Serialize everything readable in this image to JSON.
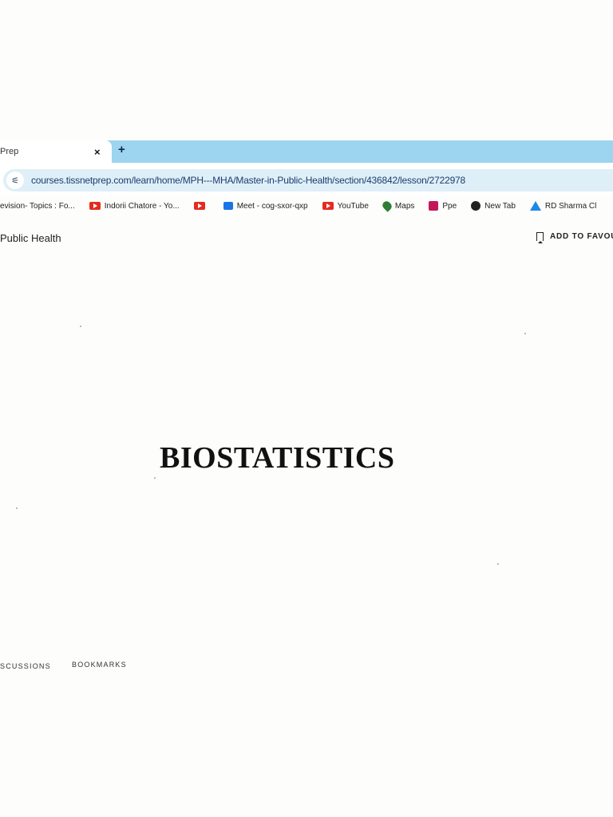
{
  "browser": {
    "active_tab_title": "Prep",
    "tab_close_glyph": "×",
    "new_tab_glyph": "+",
    "url": "courses.tissnetprep.com/learn/home/MPH---MHA/Master-in-Public-Health/section/436842/lesson/2722978",
    "bookmarks": [
      {
        "label": "evision- Topics : Fo...",
        "icon": "none"
      },
      {
        "label": "Indorii Chatore - Yo...",
        "icon": "youtube-icon"
      },
      {
        "label": "",
        "icon": "youtube-icon"
      },
      {
        "label": "Meet - cog-sxor-qxp",
        "icon": "meet-icon"
      },
      {
        "label": "YouTube",
        "icon": "youtube-icon"
      },
      {
        "label": "Maps",
        "icon": "maps-pin-icon"
      },
      {
        "label": "Ppe",
        "icon": "gift-icon"
      },
      {
        "label": "New Tab",
        "icon": "globe-icon"
      },
      {
        "label": "RD Sharma Cl",
        "icon": "drive-icon"
      }
    ]
  },
  "course": {
    "title": "Public Health",
    "add_favourite_label": "ADD TO FAVOU"
  },
  "slide": {
    "title": "BIOSTATISTICS"
  },
  "lesson_tabs": {
    "discussions": "SCUSSIONS",
    "bookmarks": "BOOKMARKS"
  }
}
